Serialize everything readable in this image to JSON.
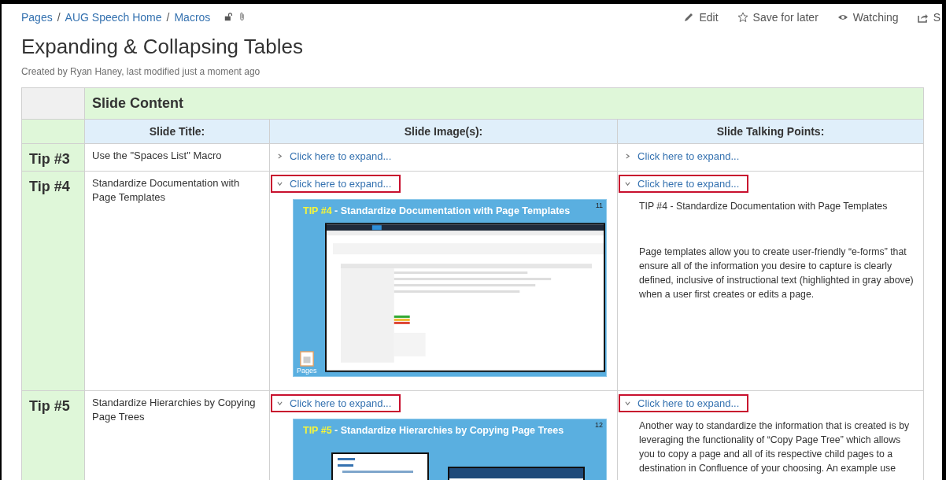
{
  "breadcrumbs": [
    "Pages",
    "AUG Speech Home",
    "Macros"
  ],
  "breadcrumb_separator": "/",
  "actions": [
    {
      "kind": "edit",
      "label": "Edit"
    },
    {
      "kind": "save",
      "label": "Save for later"
    },
    {
      "kind": "watch",
      "label": "Watching"
    },
    {
      "kind": "share",
      "label": "S"
    }
  ],
  "title": "Expanding & Collapsing Tables",
  "byline": "Created by Ryan Haney, last modified just a moment ago",
  "table": {
    "heading": "Slide Content",
    "columns": [
      "Slide Title:",
      "Slide Image(s):",
      "Slide Talking Points:"
    ],
    "rows": [
      {
        "tip": "Tip #3",
        "title": "Use the \"Spaces List\" Macro",
        "image": {
          "expander": {
            "label": "Click here to expand...",
            "expanded": false,
            "highlighted": false
          }
        },
        "points": {
          "expander": {
            "label": "Click here to expand...",
            "expanded": false,
            "highlighted": false
          }
        }
      },
      {
        "tip": "Tip #4",
        "title": "Standardize Documentation with Page Templates",
        "image": {
          "expander": {
            "label": "Click here to expand...",
            "expanded": true,
            "highlighted": true
          },
          "slide": {
            "kind": "templates",
            "tip": "TIP #4",
            "heading": " - Standardize Documentation with Page Templates",
            "number": "11",
            "badge": "Pages"
          }
        },
        "points": {
          "expander": {
            "label": "Click here to expand...",
            "expanded": true,
            "highlighted": true
          },
          "paragraphs": [
            "TIP #4 - Standardize Documentation with Page Templates",
            "Page templates allow you to create user-friendly “e-forms” that ensure all of the information you desire to capture is clearly defined, inclusive of instructional text (highlighted in gray above) when a user first creates or edits a page."
          ]
        }
      },
      {
        "tip": "Tip #5",
        "title": "Standardize Hierarchies by Copying Page Trees",
        "image": {
          "expander": {
            "label": "Click here to expand...",
            "expanded": true,
            "highlighted": true
          },
          "slide": {
            "kind": "tree",
            "tip": "TIP #5",
            "heading": " - Standardize Hierarchies by Copying Page Trees",
            "number": "12"
          }
        },
        "points": {
          "expander": {
            "label": "Click here to expand...",
            "expanded": true,
            "highlighted": true
          },
          "paragraphs": [
            "Another way to standardize the information that is created is by leveraging the functionality of “Copy Page Tree” which allows you to copy a page and all of its respective child pages to a destination in Confluence of your choosing.  An example use"
          ]
        }
      }
    ]
  }
}
